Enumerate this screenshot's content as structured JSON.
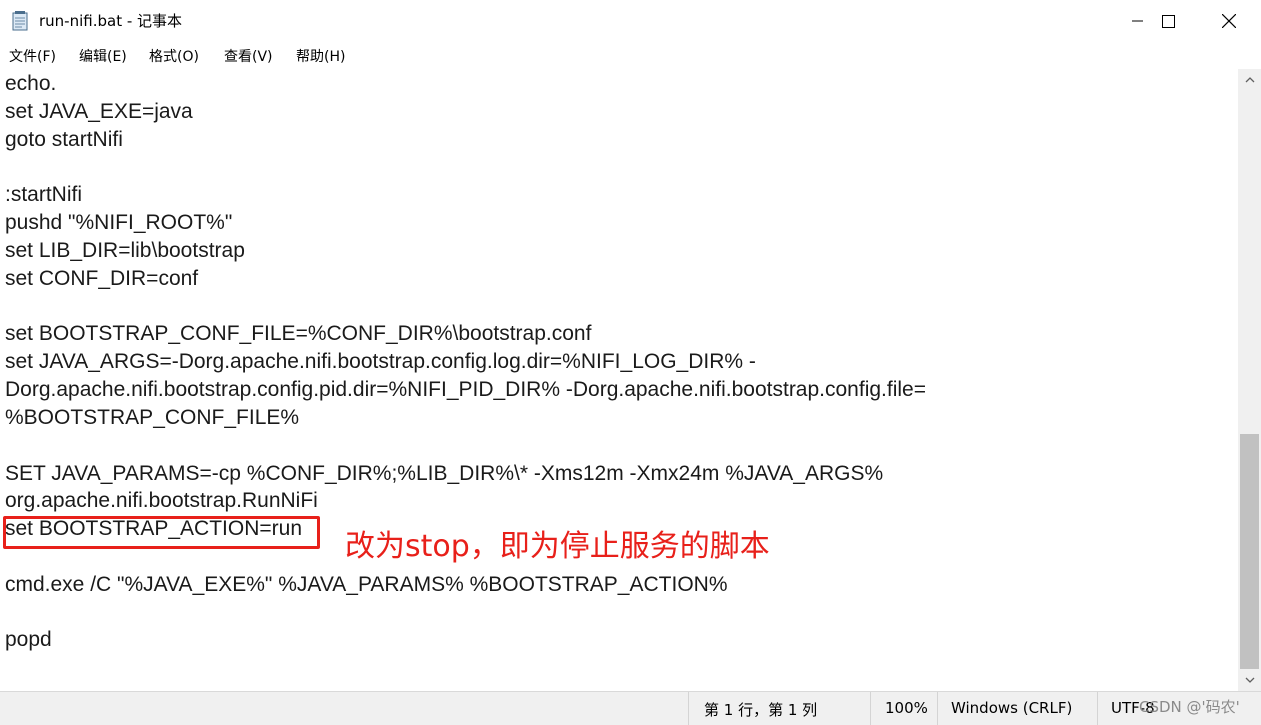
{
  "window": {
    "title": "run-nifi.bat - 记事本"
  },
  "menu": [
    "文件(F)",
    "编辑(E)",
    "格式(O)",
    "查看(V)",
    "帮助(H)"
  ],
  "editor": {
    "lines": [
      "echo.",
      "set JAVA_EXE=java",
      "goto startNifi",
      "",
      ":startNifi",
      "pushd \"%NIFI_ROOT%\"",
      "set LIB_DIR=lib\\bootstrap",
      "set CONF_DIR=conf",
      "",
      "set BOOTSTRAP_CONF_FILE=%CONF_DIR%\\bootstrap.conf",
      "set JAVA_ARGS=-Dorg.apache.nifi.bootstrap.config.log.dir=%NIFI_LOG_DIR% -",
      "Dorg.apache.nifi.bootstrap.config.pid.dir=%NIFI_PID_DIR% -Dorg.apache.nifi.bootstrap.config.file=",
      "%BOOTSTRAP_CONF_FILE%",
      "",
      "SET JAVA_PARAMS=-cp %CONF_DIR%;%LIB_DIR%\\* -Xms12m -Xmx24m %JAVA_ARGS%",
      "org.apache.nifi.bootstrap.RunNiFi",
      "set BOOTSTRAP_ACTION=run",
      "",
      "cmd.exe /C \"%JAVA_EXE%\" %JAVA_PARAMS% %BOOTSTRAP_ACTION%",
      "",
      "popd"
    ]
  },
  "annotation": {
    "text": "改为stop，即为停止服务的脚本",
    "color": "#e8201a"
  },
  "statusbar": {
    "position": "第 1 行，第 1 列",
    "zoom": "100%",
    "line_ending": "Windows (CRLF)",
    "encoding": "UTF-8"
  },
  "watermark": "CSDN @'码农'"
}
